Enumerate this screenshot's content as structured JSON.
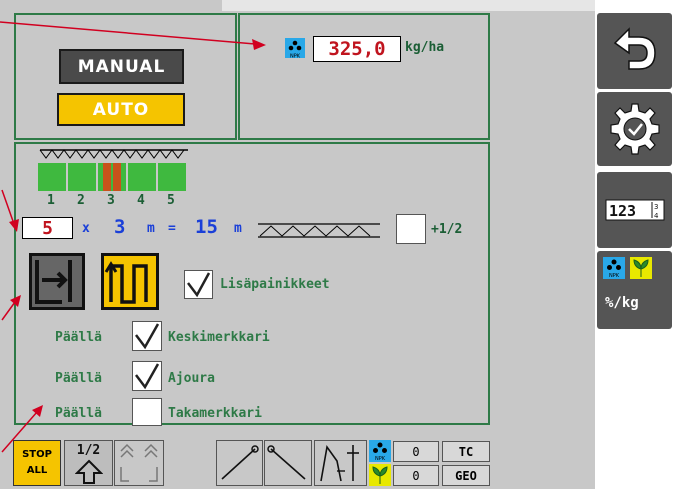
{
  "mode": {
    "manual_label": "MANUAL",
    "auto_label": "AUTO"
  },
  "rate": {
    "value": "325,0",
    "unit": "kg/ha"
  },
  "sections": {
    "numbers": [
      "1",
      "2",
      "3",
      "4",
      "5"
    ],
    "multiplier": "5",
    "times": "x",
    "width_value": "3",
    "width_unit": "m",
    "equals": "=",
    "total_value": "15",
    "total_unit": "m",
    "half_label": "+1/2",
    "extra_buttons_label": "Lisäpainikkeet"
  },
  "markers": [
    {
      "state": "Päällä",
      "label": "Keskimerkkari",
      "checked": true
    },
    {
      "state": "Päällä",
      "label": "Ajoura",
      "checked": true
    },
    {
      "state": "Päällä",
      "label": "Takamerkkari",
      "checked": false
    }
  ],
  "bottom": {
    "stop_line1": "STOP",
    "stop_line2": "ALL",
    "half_label": "1/2",
    "npk_count": "0",
    "seed_count": "0",
    "tc_label": "TC",
    "geo_label": "GEO"
  },
  "right_panel": {
    "unit_label": "%/kg",
    "counter_digits": "123"
  },
  "colors": {
    "accent_green": "#2e7a47",
    "auto_yellow": "#f5c400",
    "npk_blue": "#29a8e8",
    "value_red": "#c0141e",
    "count_blue": "#1a3fd8"
  },
  "icons": [
    "undo-icon",
    "settings-check-icon",
    "counter-icon",
    "npk-icon",
    "seed-icon",
    "stop-icon",
    "arrow-up-icon",
    "section-edge-icon",
    "tramline-icon",
    "marker-left-icon",
    "marker-right-icon",
    "rear-marker-icon"
  ]
}
